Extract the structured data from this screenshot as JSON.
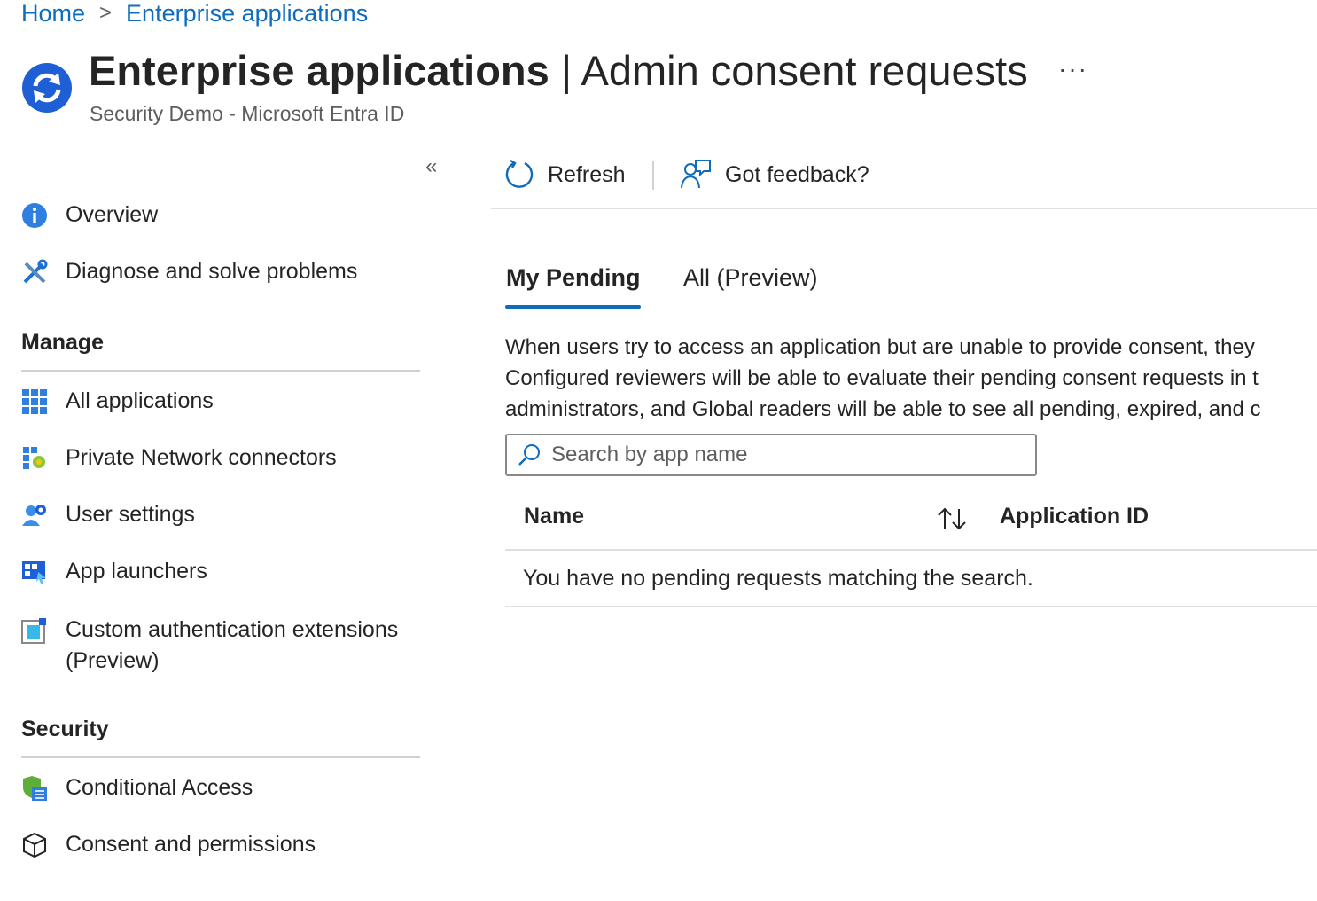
{
  "breadcrumb": {
    "home": "Home",
    "current": "Enterprise applications",
    "separator": ">"
  },
  "header": {
    "title_bold": "Enterprise applications",
    "title_rest": " | Admin consent requests",
    "subtitle": "Security Demo - Microsoft Entra ID",
    "more": "···",
    "icon": "refresh-circle-icon"
  },
  "sidebar": {
    "collapse": "«",
    "items_top": [
      {
        "label": "Overview",
        "icon": "info-icon"
      },
      {
        "label": "Diagnose and solve problems",
        "icon": "wrench-icon"
      }
    ],
    "manage": {
      "heading": "Manage",
      "items": [
        {
          "label": "All applications",
          "icon": "grid-icon"
        },
        {
          "label": "Private Network connectors",
          "icon": "connector-icon"
        },
        {
          "label": "User settings",
          "icon": "user-settings-icon"
        },
        {
          "label": "App launchers",
          "icon": "app-launcher-icon"
        },
        {
          "label": "Custom authentication extensions",
          "label2": "(Preview)",
          "icon": "extension-icon"
        }
      ]
    },
    "security": {
      "heading": "Security",
      "items": [
        {
          "label": "Conditional Access",
          "icon": "shield-list-icon"
        },
        {
          "label": "Consent and permissions",
          "icon": "cube-icon"
        }
      ]
    }
  },
  "toolbar": {
    "refresh": "Refresh",
    "feedback": "Got feedback?"
  },
  "tabs": [
    {
      "label": "My Pending",
      "active": true
    },
    {
      "label": "All (Preview)",
      "active": false
    }
  ],
  "description": {
    "line1": "When users try to access an application but are unable to provide consent, they",
    "line2": "Configured reviewers will be able to evaluate their pending consent requests in t",
    "line3": "administrators, and Global readers will be able to see all pending, expired, and c"
  },
  "search": {
    "placeholder": "Search by app name",
    "value": ""
  },
  "table": {
    "columns": [
      "Name",
      "Application ID"
    ],
    "empty_message": "You have no pending requests matching the search."
  },
  "colors": {
    "accent": "#0f6cbd",
    "text": "#242424",
    "muted": "#605e5c"
  }
}
